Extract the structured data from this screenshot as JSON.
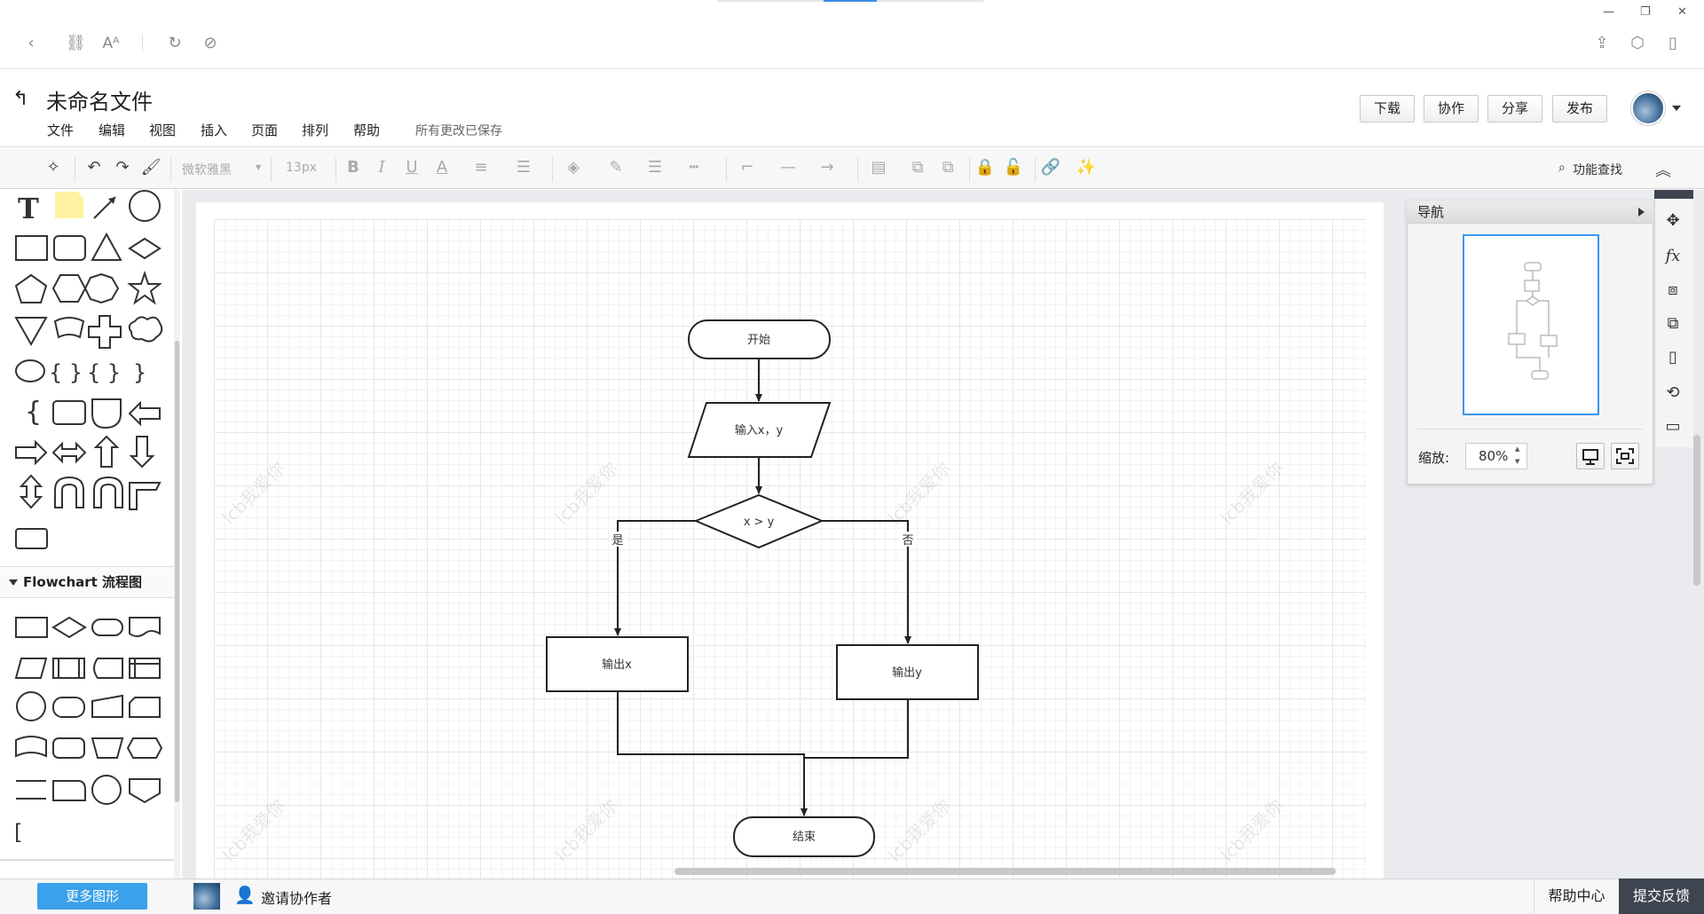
{
  "document": {
    "title": "未命名文件",
    "saved_status": "所有更改已保存"
  },
  "menu": [
    "文件",
    "编辑",
    "视图",
    "插入",
    "页面",
    "排列",
    "帮助"
  ],
  "top_buttons": {
    "download": "下载",
    "collaborate": "协作",
    "share": "分享",
    "publish": "发布"
  },
  "toolbar": {
    "font_family": "微软雅黑",
    "font_size": "13px",
    "search_label": "功能查找"
  },
  "sidebar": {
    "flowchart_header": "Flowchart 流程图"
  },
  "flowchart": {
    "start": "开始",
    "input": "输入x，y",
    "decision": "x > y",
    "yes_label": "是",
    "no_label": "否",
    "output_x": "输出x",
    "output_y": "输出y",
    "end": "结束"
  },
  "watermark": "lcb我爱你",
  "navigator": {
    "title": "导航",
    "zoom_label": "缩放:",
    "zoom_value": "80%"
  },
  "bottom": {
    "more_shapes": "更多图形",
    "invite": "邀请协作者",
    "help_center": "帮助中心",
    "feedback": "提交反馈"
  }
}
